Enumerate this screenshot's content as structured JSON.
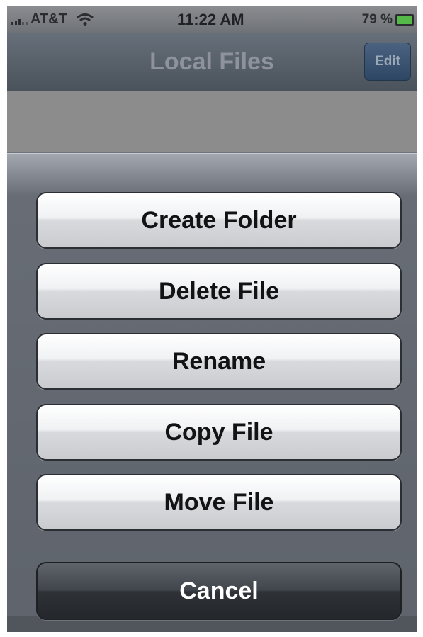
{
  "status_bar": {
    "carrier": "AT&T",
    "time": "11:22 AM",
    "battery_percent": "79 %",
    "battery_color": "#56b848"
  },
  "nav_bar": {
    "title": "Local Files",
    "edit_label": "Edit"
  },
  "action_sheet": {
    "buttons": [
      {
        "label": "Create Folder"
      },
      {
        "label": "Delete File"
      },
      {
        "label": "Rename"
      },
      {
        "label": "Copy File"
      },
      {
        "label": "Move File"
      }
    ],
    "cancel_label": "Cancel"
  }
}
